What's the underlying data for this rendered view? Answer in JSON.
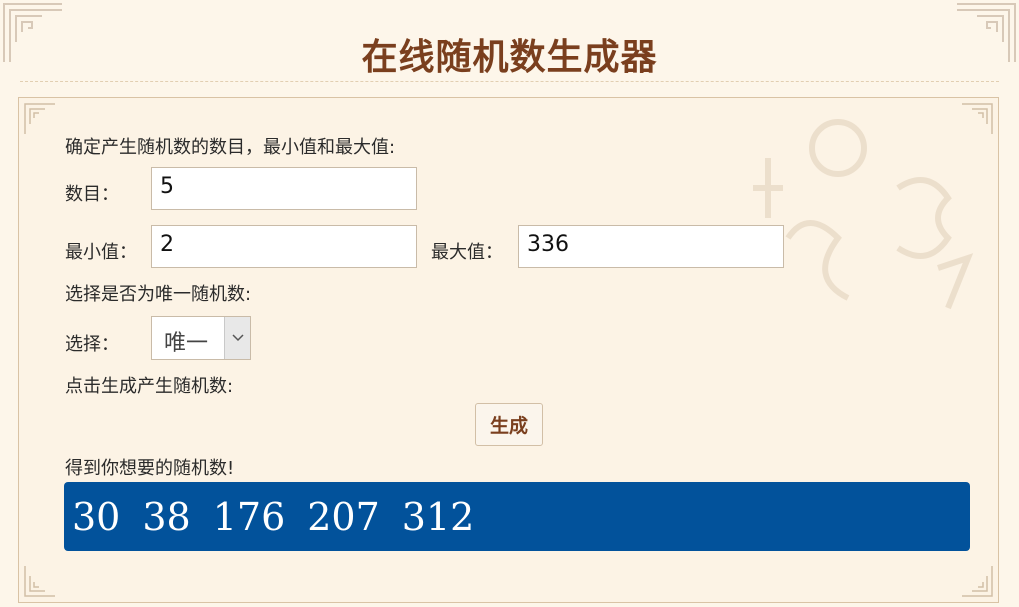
{
  "page": {
    "title": "在线随机数生成器"
  },
  "form": {
    "intro_label": "确定产生随机数的数目，最小值和最大值:",
    "count_label": "数目：",
    "count_value": "5",
    "min_label": "最小值：",
    "min_value": "2",
    "max_label": "最大值：",
    "max_value": "336",
    "unique_intro": "选择是否为唯一随机数:",
    "choice_label": "选择：",
    "choice_selected": "唯一",
    "generate_intro": "点击生成产生随机数:",
    "generate_button": "生成",
    "result_label": "得到你想要的随机数!",
    "results": [
      "30",
      "38",
      "176",
      "207",
      "312"
    ]
  },
  "colors": {
    "title": "#7a3f1e",
    "result_background": "#02529b",
    "page_background": "#fdf6ea"
  },
  "icons": {
    "select_arrow": "chevron-down-icon",
    "corner": "ornament-corner-icon"
  }
}
